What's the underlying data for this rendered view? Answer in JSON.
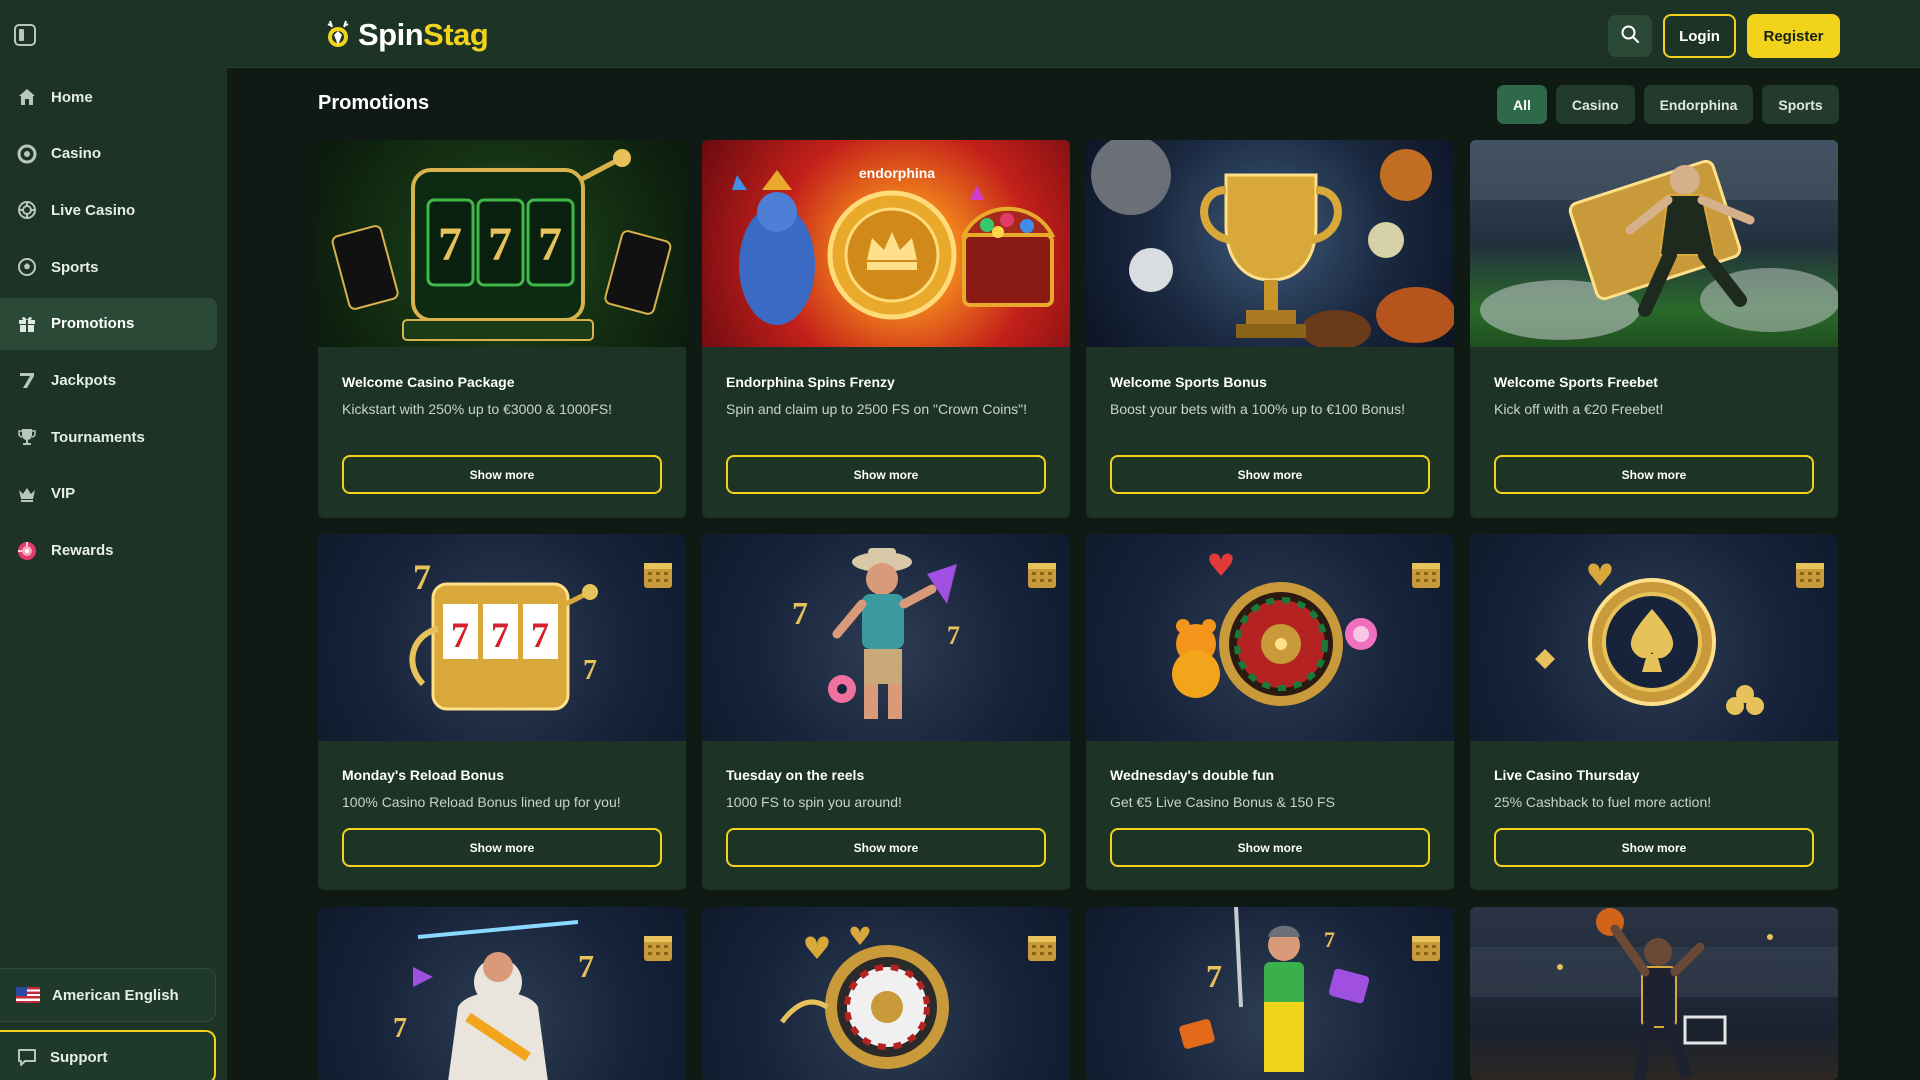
{
  "brand": {
    "name_part1": "Spin",
    "name_part2": "Stag"
  },
  "sidebar": {
    "items": [
      {
        "label": "Home",
        "icon": "home-icon"
      },
      {
        "label": "Casino",
        "icon": "casino-chip-icon"
      },
      {
        "label": "Live Casino",
        "icon": "live-casino-icon"
      },
      {
        "label": "Sports",
        "icon": "soccer-ball-icon"
      },
      {
        "label": "Promotions",
        "icon": "gift-icon",
        "active": true
      },
      {
        "label": "Jackpots",
        "icon": "jackpot-seven-icon"
      },
      {
        "label": "Tournaments",
        "icon": "trophy-icon"
      },
      {
        "label": "VIP",
        "icon": "crown-icon"
      },
      {
        "label": "Rewards",
        "icon": "rewards-wheel-icon"
      }
    ],
    "language": "American English",
    "support": "Support"
  },
  "header": {
    "login": "Login",
    "register": "Register"
  },
  "main": {
    "title": "Promotions",
    "filters": [
      {
        "label": "All",
        "active": true
      },
      {
        "label": "Casino"
      },
      {
        "label": "Endorphina"
      },
      {
        "label": "Sports"
      }
    ],
    "show_more_label": "Show more",
    "cards": [
      {
        "title": "Welcome Casino Package",
        "desc": "Kickstart with 250% up to €3000 & 1000FS!",
        "image": "slot-machine-777"
      },
      {
        "title": "Endorphina Spins Frenzy",
        "desc": "Spin and claim up to 2500 FS on \"Crown Coins\"!",
        "image": "endorphina-crown-coin",
        "image_text": "endorphina"
      },
      {
        "title": "Welcome Sports Bonus",
        "desc": "Boost your bets with a 100% up to €100 Bonus!",
        "image": "golden-trophy"
      },
      {
        "title": "Welcome Sports Freebet",
        "desc": "Kick off with a €20 Freebet!",
        "image": "football-player-ticket"
      },
      {
        "title": "Monday's Reload Bonus",
        "desc": "100% Casino Reload Bonus lined up for you!",
        "image": "golden-slot-machine"
      },
      {
        "title": "Tuesday on the reels",
        "desc": "1000 FS to spin you around!",
        "image": "cowboy-character"
      },
      {
        "title": "Wednesday's double fun",
        "desc": "Get €5 Live Casino Bonus & 150 FS",
        "image": "roulette-gummy-bear"
      },
      {
        "title": "Live Casino Thursday",
        "desc": "25% Cashback to fuel more action!",
        "image": "gold-spade-chip"
      },
      {
        "image": "zeus-character"
      },
      {
        "image": "roulette-wheel"
      },
      {
        "image": "miner-character"
      },
      {
        "image": "basketball-player"
      }
    ]
  }
}
